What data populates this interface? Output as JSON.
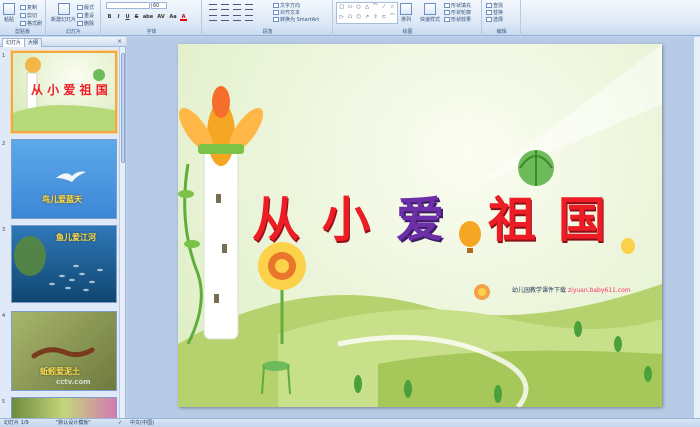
{
  "ribbon": {
    "clipboard": {
      "paste": "粘贴",
      "copy": "复制",
      "cut": "剪切",
      "format_painter": "格式刷",
      "group": "剪贴板"
    },
    "slides": {
      "new_slide": "新建幻灯片",
      "layout": "版式",
      "reset": "重设",
      "delete": "删除",
      "group": "幻灯片"
    },
    "font": {
      "name": "",
      "size": "60",
      "bold": "B",
      "italic": "I",
      "underline": "U",
      "strike": "S",
      "shadow": "abe",
      "spacing": "AV",
      "case": "Aa",
      "color": "A",
      "group": "字体"
    },
    "paragraph": {
      "text_direction": "文字方向",
      "align_text": "对齐文本",
      "smartart": "转换为 SmartArt",
      "group": "段落"
    },
    "drawing": {
      "shapes": [
        "□",
        "▭",
        "○",
        "△",
        "⌒",
        "⟋",
        "☆",
        "▷",
        "⬠",
        "⬡",
        "↗",
        "⇧",
        "⊂",
        "⌒"
      ],
      "arrange": "排列",
      "quick_styles": "快速样式",
      "shape_fill": "形状填充",
      "shape_outline": "形状轮廓",
      "shape_effects": "形状效果",
      "group": "绘图"
    },
    "editing": {
      "find": "查找",
      "replace": "替换",
      "select": "选择",
      "group": "编辑"
    }
  },
  "left_panel": {
    "tabs": [
      {
        "label": "幻灯片"
      },
      {
        "label": "大纲"
      }
    ],
    "close": "×",
    "thumbs": [
      {
        "num": "1",
        "title": "从 小 爱 祖 国"
      },
      {
        "num": "2",
        "title": "鸟儿爱蓝天"
      },
      {
        "num": "3",
        "title": "鱼儿爱江河"
      },
      {
        "num": "4",
        "title": "蚯蚓爱泥土",
        "watermark": "cctv.com"
      },
      {
        "num": "5",
        "title": ""
      }
    ]
  },
  "slide": {
    "title_chars": [
      "从",
      "小",
      "爱",
      "祖",
      "国"
    ],
    "credit_text": "幼儿园教学课件下载",
    "credit_link": "ziyuan.baby611.com"
  },
  "status": {
    "slide_indicator": "幻灯片 1/9",
    "theme": "\"默认设计模板\"",
    "language": "中文(中国)"
  }
}
